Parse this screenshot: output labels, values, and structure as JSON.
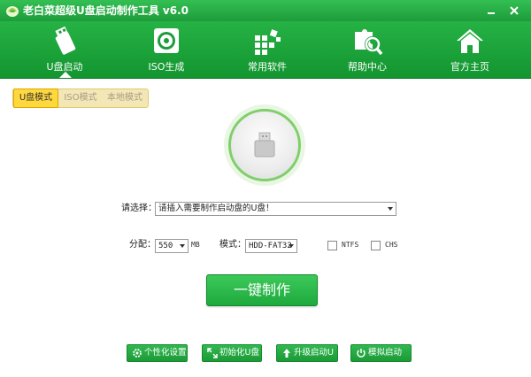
{
  "window": {
    "title": "老白菜超级U盘启动制作工具 v6.0"
  },
  "nav": {
    "items": [
      {
        "label": "U盘启动",
        "icon": "usb-drive-icon"
      },
      {
        "label": "ISO生成",
        "icon": "disc-icon"
      },
      {
        "label": "常用软件",
        "icon": "apps-grid-icon"
      },
      {
        "label": "帮助中心",
        "icon": "puzzle-search-icon"
      },
      {
        "label": "官方主页",
        "icon": "home-icon"
      }
    ],
    "active_index": 0
  },
  "mode_tabs": {
    "items": [
      "U盘模式",
      "ISO模式",
      "本地模式"
    ],
    "active_index": 0
  },
  "device": {
    "label": "请选择：",
    "value": "请插入需要制作启动盘的U盘！"
  },
  "partition": {
    "label": "分配：",
    "value": "550",
    "unit": "MB"
  },
  "mode": {
    "label": "模式：",
    "value": "HDD-FAT32"
  },
  "options": {
    "ntfs_label": "NTFS",
    "ntfs_checked": false,
    "chs_label": "CHS",
    "chs_checked": false
  },
  "make_button": {
    "label": "一键制作"
  },
  "footer": {
    "buttons": [
      {
        "label": "个性化设置",
        "icon": "gear-icon"
      },
      {
        "label": "初始化U盘",
        "icon": "expand-arrows-icon"
      },
      {
        "label": "升级启动U盘",
        "icon": "upgrade-arrow-icon"
      },
      {
        "label": "模拟启动",
        "icon": "power-icon"
      }
    ]
  },
  "colors": {
    "brand_green": "#1e9c3b",
    "tab_active": "#ffd83d",
    "accent_ring": "#7fcf6a"
  }
}
